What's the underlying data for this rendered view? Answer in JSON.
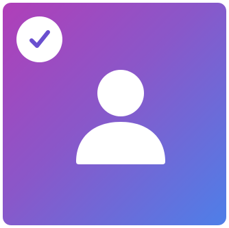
{
  "tile": {
    "gradient_start": "#b03fb8",
    "gradient_end": "#4e7fe8",
    "selected": true
  },
  "badge": {
    "icon": "checkmark-icon",
    "check_color": "#6a4fcf",
    "background": "#ffffff"
  },
  "avatar": {
    "icon": "user-silhouette-icon",
    "color": "#ffffff"
  }
}
